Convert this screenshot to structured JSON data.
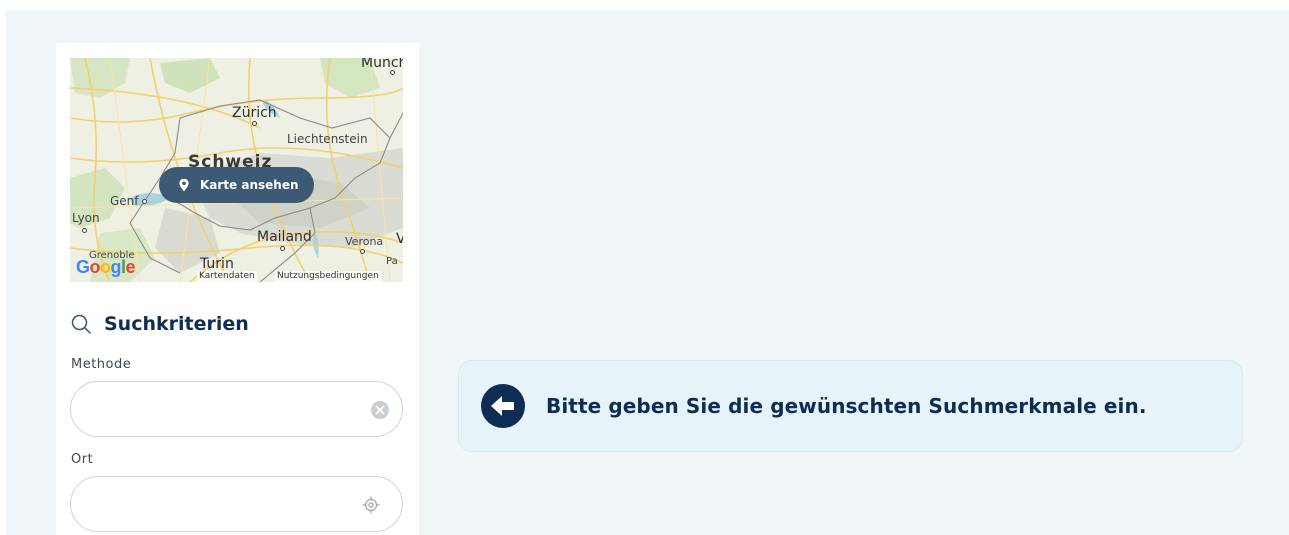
{
  "map": {
    "labels": {
      "munich": "Munch",
      "zurich": "Zürich",
      "liechtenstein": "Liechtenstein",
      "schweiz": "Schweiz",
      "genf": "Genf",
      "lyon": "Lyon",
      "mailand": "Mailand",
      "verona": "Verona",
      "turin": "Turin",
      "grenoble": "Grenoble",
      "pa": "Pa",
      "v": "V"
    },
    "view_button_label": "Karte ansehen",
    "attribution_data": "Kartendaten",
    "attribution_terms": "Nutzungsbedingungen",
    "google_logo": "Google"
  },
  "criteria": {
    "title": "Suchkriterien",
    "method_label": "Methode",
    "method_value": "",
    "place_label": "Ort",
    "place_value": ""
  },
  "notice": {
    "text": "Bitte geben Sie die gewünschten Suchmerkmale ein."
  },
  "colors": {
    "brand_navy": "#0e2c54",
    "page_bg": "#f0f5f8",
    "notice_bg": "#e6f3f8",
    "map_button_bg": "#3c5a75"
  },
  "icons": {
    "search": "search-icon",
    "clear": "clear-icon",
    "locate": "locate-icon",
    "pin": "map-pin-icon",
    "back": "arrow-left-icon"
  }
}
